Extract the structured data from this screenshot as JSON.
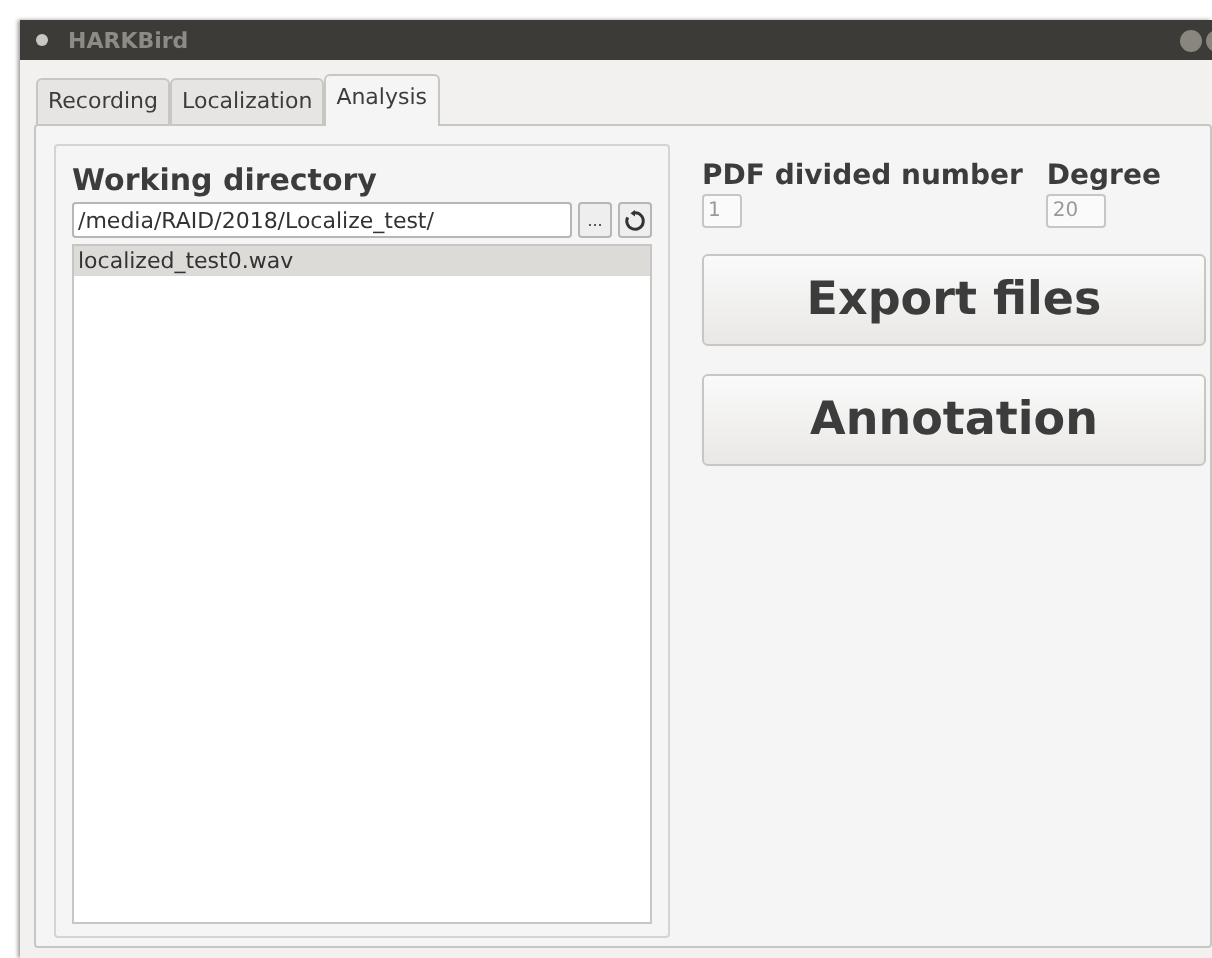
{
  "window": {
    "title": "HARKBird"
  },
  "tabs": [
    {
      "label": "Recording",
      "selected": false
    },
    {
      "label": "Localization",
      "selected": false
    },
    {
      "label": "Analysis",
      "selected": true
    }
  ],
  "working_directory": {
    "title": "Working directory",
    "path": "/media/RAID/2018/Localize_test/",
    "browse_button": "...",
    "files": [
      {
        "name": "localized_test0.wav",
        "selected": true
      }
    ]
  },
  "pdf_divided_number": {
    "label": "PDF divided number",
    "value": "1"
  },
  "degree": {
    "label": "Degree",
    "value": "20"
  },
  "buttons": [
    "Export files",
    "Annotation"
  ]
}
